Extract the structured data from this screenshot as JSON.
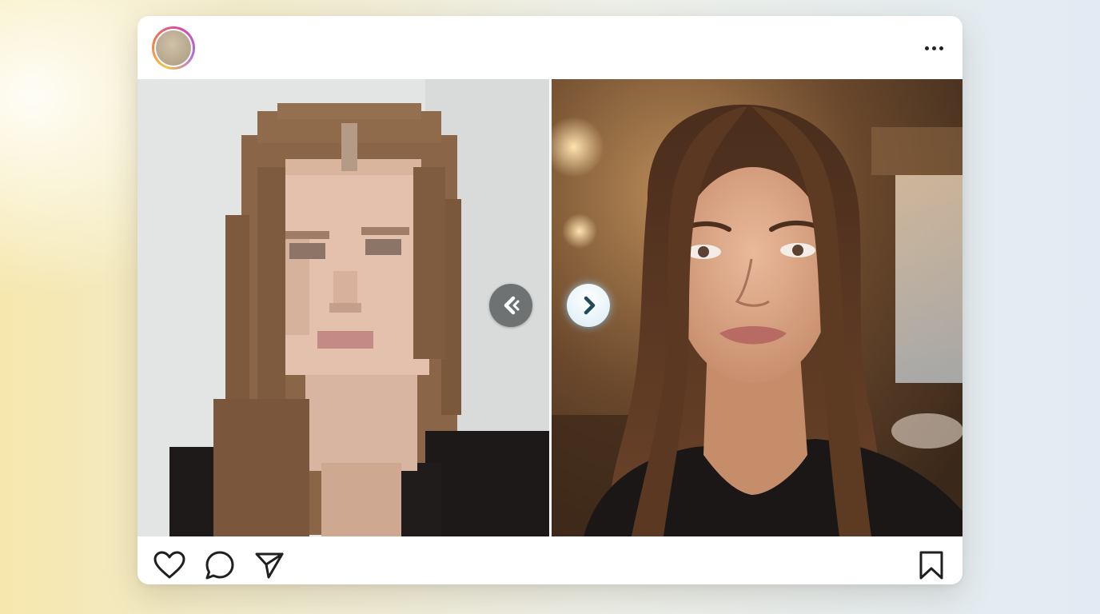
{
  "post": {
    "avatar": {
      "icon": "profile-avatar"
    },
    "menu": {
      "icon": "more-horizontal-icon"
    },
    "media": {
      "left_image": {
        "icon": "pixelated-portrait",
        "style": "low-resolution pixelated"
      },
      "right_image": {
        "icon": "sharp-portrait",
        "style": "high-resolution"
      },
      "prev_icon": "chevron-left-icon",
      "next_icon": "chevron-right-icon"
    },
    "actions": {
      "like_icon": "heart-icon",
      "comment_icon": "comment-icon",
      "share_icon": "send-icon",
      "save_icon": "bookmark-icon"
    }
  },
  "colors": {
    "background_left": "#f6e7ad",
    "background_right": "#e2ebf3",
    "card": "#ffffff",
    "icon": "#1f1f1f",
    "avatar_ring": [
      "#f3c24d",
      "#f27a4e",
      "#d54aa6",
      "#b06be0"
    ],
    "next_glow": "#a0d2eb"
  }
}
